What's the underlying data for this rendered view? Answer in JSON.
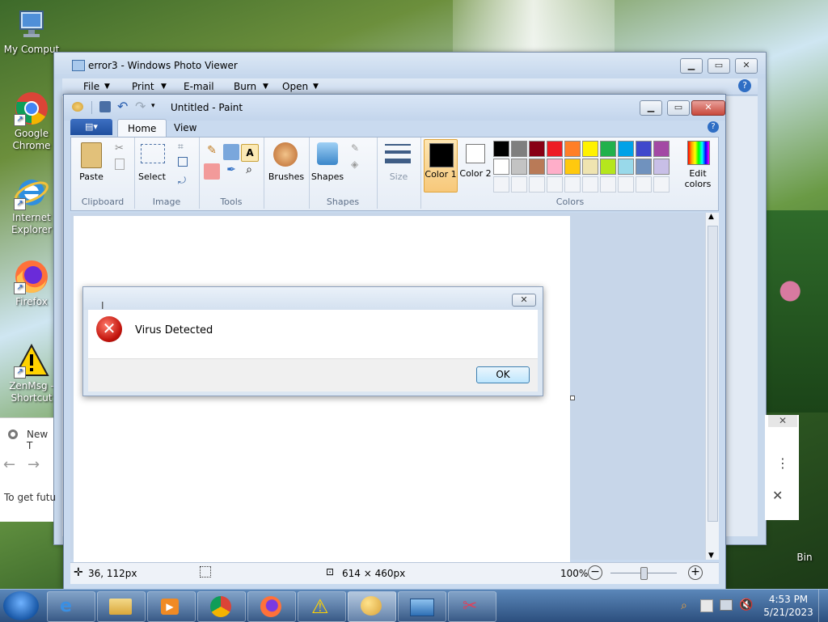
{
  "desktop": {
    "icons": [
      {
        "label": "My Comput"
      },
      {
        "label": "Google Chrome"
      },
      {
        "label": "Internet Explorer"
      },
      {
        "label": "Firefox"
      },
      {
        "label": "ZenMsg - Shortcut"
      }
    ],
    "recycle_bin_label": "Bin"
  },
  "chrome_window": {
    "tab_label": "New T",
    "body_text": "To get futu"
  },
  "photo_viewer": {
    "title": "error3 - Windows Photo Viewer",
    "menu": [
      "File",
      "Print",
      "E-mail",
      "Burn",
      "Open"
    ]
  },
  "paint": {
    "title": "Untitled - Paint",
    "tabs": {
      "file": "▤▾",
      "home": "Home",
      "view": "View"
    },
    "groups": {
      "clipboard": {
        "label": "Clipboard",
        "paste": "Paste"
      },
      "image": {
        "label": "Image",
        "select": "Select"
      },
      "tools": {
        "label": "Tools"
      },
      "shapes": {
        "label": "Shapes",
        "brushes": "Brushes",
        "shapes": "Shapes"
      },
      "size": {
        "label": "Size"
      },
      "colors": {
        "label": "Colors",
        "color1": "Color 1",
        "color2": "Color 2",
        "edit": "Edit colors"
      }
    },
    "palette_row1": [
      "#000000",
      "#7f7f7f",
      "#880015",
      "#ed1c24",
      "#ff7f27",
      "#fff200",
      "#22b14c",
      "#00a2e8",
      "#3f48cc",
      "#a349a4"
    ],
    "palette_row2": [
      "#ffffff",
      "#c3c3c3",
      "#b97a57",
      "#ffaec9",
      "#ffc90e",
      "#efe4b0",
      "#b5e61d",
      "#99d9ea",
      "#7092be",
      "#c8bfe7"
    ],
    "status": {
      "cursor": "36, 112px",
      "selection": "",
      "size": "614 × 460px",
      "zoom": "100%"
    }
  },
  "dialog": {
    "title": "",
    "message": "Virus Detected",
    "ok": "OK"
  },
  "taskbar": {
    "time": "4:53 PM",
    "date": "5/21/2023"
  }
}
